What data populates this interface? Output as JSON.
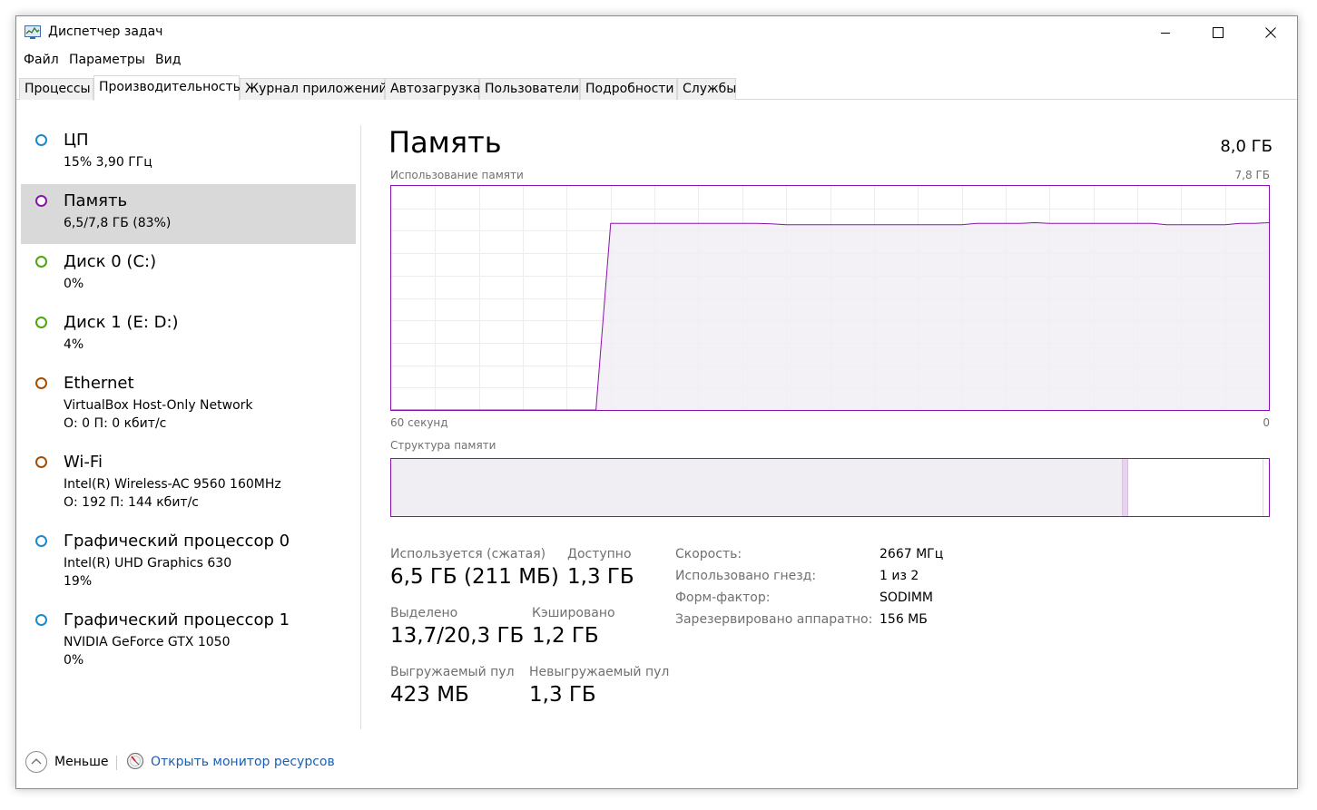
{
  "window": {
    "title": "Диспетчер задач",
    "app_icon": "task-manager-icon",
    "controls": {
      "minimize": "minimize-icon",
      "maximize": "maximize-icon",
      "close": "close-icon"
    }
  },
  "menu": [
    "Файл",
    "Параметры",
    "Вид"
  ],
  "tabs": [
    {
      "label": "Процессы",
      "active": false
    },
    {
      "label": "Производительность",
      "active": true
    },
    {
      "label": "Журнал приложений",
      "active": false
    },
    {
      "label": "Автозагрузка",
      "active": false
    },
    {
      "label": "Пользователи",
      "active": false
    },
    {
      "label": "Подробности",
      "active": false
    },
    {
      "label": "Службы",
      "active": false
    }
  ],
  "sidebar": {
    "items": [
      {
        "title": "ЦП",
        "line1": "15%  3,90 ГГц",
        "line2": "",
        "color": "#1a8ad0",
        "selected": false
      },
      {
        "title": "Память",
        "line1": "6,5/7,8 ГБ (83%)",
        "line2": "",
        "color": "#8b12ae",
        "selected": true
      },
      {
        "title": "Диск 0 (C:)",
        "line1": "0%",
        "line2": "",
        "color": "#4da60c",
        "selected": false
      },
      {
        "title": "Диск 1 (E: D:)",
        "line1": "4%",
        "line2": "",
        "color": "#4da60c",
        "selected": false
      },
      {
        "title": "Ethernet",
        "line1": "VirtualBox Host-Only Network",
        "line2": "О: 0  П: 0 кбит/с",
        "color": "#a74f01",
        "selected": false
      },
      {
        "title": "Wi-Fi",
        "line1": "Intel(R) Wireless-AC 9560 160MHz",
        "line2": "О: 192  П: 144 кбит/с",
        "color": "#a74f01",
        "selected": false
      },
      {
        "title": "Графический процессор 0",
        "line1": "Intel(R) UHD Graphics 630",
        "line2": "19%",
        "color": "#1a8ad0",
        "selected": false
      },
      {
        "title": "Графический процессор 1",
        "line1": "NVIDIA GeForce GTX 1050",
        "line2": "0%",
        "color": "#1a8ad0",
        "selected": false
      }
    ]
  },
  "main": {
    "title": "Память",
    "total": "8,0 ГБ",
    "usage_label": "Использование памяти",
    "usage_max": "7,8 ГБ",
    "axis_left": "60 секунд",
    "axis_right": "0",
    "composition_label": "Структура памяти",
    "accent_color": "#8b12ae",
    "fill_color": "#f1eef3",
    "stats": {
      "in_use_label": "Используется (сжатая)",
      "in_use_value": "6,5 ГБ (211 МБ)",
      "available_label": "Доступно",
      "available_value": "1,3 ГБ",
      "committed_label": "Выделено",
      "committed_value": "13,7/20,3 ГБ",
      "cached_label": "Кэшировано",
      "cached_value": "1,2 ГБ",
      "paged_label": "Выгружаемый пул",
      "paged_value": "423 МБ",
      "nonpaged_label": "Невыгружаемый пул",
      "nonpaged_value": "1,3 ГБ"
    },
    "details": [
      {
        "label": "Скорость:",
        "value": "2667 МГц"
      },
      {
        "label": "Использовано гнезд:",
        "value": "1 из 2"
      },
      {
        "label": "Форм-фактор:",
        "value": "SODIMM"
      },
      {
        "label": "Зарезервировано аппаратно:",
        "value": "156 МБ"
      }
    ]
  },
  "chart_data": {
    "type": "area",
    "x": [
      60,
      59,
      58,
      57,
      56,
      55,
      54,
      53,
      52,
      51,
      50,
      49,
      48,
      47,
      46,
      45,
      44,
      43,
      42,
      41,
      40,
      39,
      38,
      37,
      36,
      35,
      34,
      33,
      32,
      31,
      30,
      29,
      28,
      27,
      26,
      25,
      24,
      23,
      22,
      21,
      20,
      19,
      18,
      17,
      16,
      15,
      14,
      13,
      12,
      11,
      10,
      9,
      8,
      7,
      6,
      5,
      4,
      3,
      2,
      1,
      0
    ],
    "series": [
      {
        "values": [
          0,
          0,
          0,
          0,
          0,
          0,
          0,
          0,
          0,
          0,
          0,
          0,
          0,
          0,
          0,
          6.5,
          6.5,
          6.5,
          6.5,
          6.5,
          6.5,
          6.5,
          6.5,
          6.5,
          6.5,
          6.5,
          6.48,
          6.45,
          6.45,
          6.45,
          6.45,
          6.45,
          6.45,
          6.45,
          6.45,
          6.45,
          6.45,
          6.45,
          6.45,
          6.45,
          6.5,
          6.5,
          6.5,
          6.5,
          6.52,
          6.5,
          6.5,
          6.5,
          6.5,
          6.5,
          6.5,
          6.5,
          6.5,
          6.45,
          6.45,
          6.45,
          6.45,
          6.45,
          6.5,
          6.5,
          6.52
        ]
      }
    ],
    "ylim": [
      0,
      7.8
    ],
    "xlim": [
      60,
      0
    ],
    "grid": true,
    "composition": {
      "in_use": 6.5,
      "modified": 0.05,
      "standby": 1.2,
      "free": 0.1,
      "total": 7.8
    }
  },
  "footer": {
    "less_icon": "chevron-up-icon",
    "less_label": "Меньше",
    "monitor_icon": "resource-monitor-icon",
    "monitor_label": "Открыть монитор ресурсов"
  }
}
